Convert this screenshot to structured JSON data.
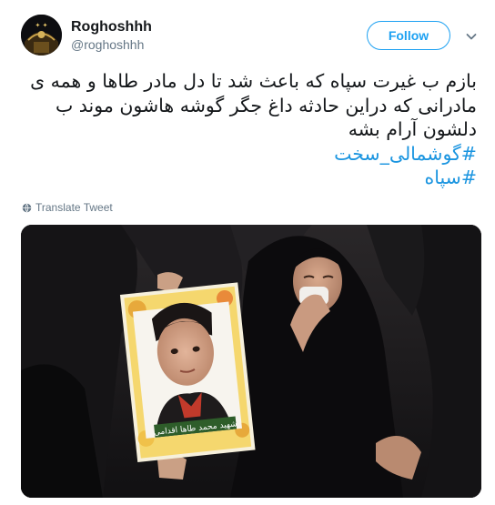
{
  "author": {
    "display_name": "Roghoshhh",
    "handle": "@roghoshhh"
  },
  "follow_button": {
    "label": "Follow"
  },
  "tweet": {
    "lines": [
      "بازم ب غیرت سپاه که باعث شد تا دل مادر طاها و همه ی",
      "مادرانی که دراین حادثه داغ جگر گوشه هاشون موند ب",
      "دلشون آرام بشه"
    ],
    "hashtags": [
      "#گوشمالی_سخت",
      "#سپاه"
    ]
  },
  "translate": {
    "label": "Translate Tweet"
  },
  "photo": {
    "poster_caption": "شهید محمد طاها اقدامی"
  },
  "colors": {
    "accent": "#1da1f2",
    "hashtag": "#1b95e0",
    "muted": "#657786",
    "text": "#14171a"
  },
  "icons": {
    "caret": "chevron-down-icon",
    "translate": "globe-icon"
  }
}
